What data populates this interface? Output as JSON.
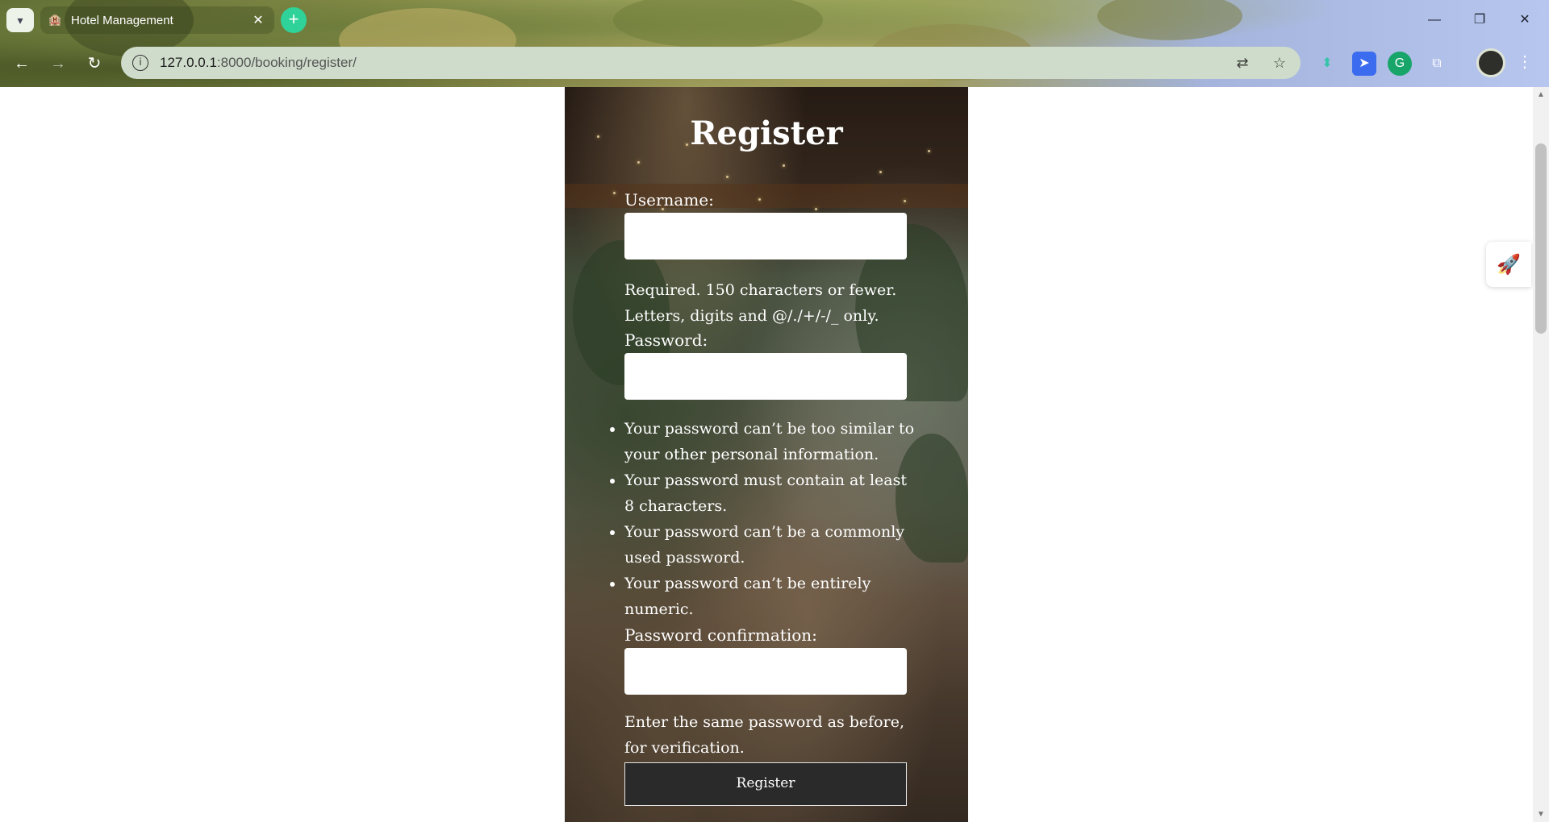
{
  "browser": {
    "tab_title": "Hotel Management",
    "tab_close": "✕",
    "new_tab": "+",
    "url_host": "127.0.0.1",
    "url_path": ":8000/booking/register/",
    "window_buttons": {
      "minimize": "—",
      "restore": "❐",
      "close": "✕"
    }
  },
  "icons": {
    "tab_menu": "chevron-down-icon",
    "back": "arrow-left-icon",
    "forward": "arrow-right-icon",
    "reload": "reload-icon",
    "site_info": "info-icon",
    "translate": "translate-icon",
    "bookmark": "star-icon",
    "extensions": "puzzle-icon",
    "menu": "kebab-menu-icon",
    "side_widget": "rocket-icon"
  },
  "form": {
    "title": "Register",
    "username_label": "Username:",
    "username_help": "Required. 150 characters or fewer. Letters, digits and @/./+/-/_ only.",
    "password_label": "Password:",
    "password_rules": [
      "Your password can’t be too similar to your other personal information.",
      "Your password must contain at least 8 characters.",
      "Your password can’t be a commonly used password.",
      "Your password can’t be entirely numeric."
    ],
    "confirm_label": "Password confirmation:",
    "confirm_help": "Enter the same password as before, for verification.",
    "submit_label": "Register"
  },
  "colors": {
    "submit_bg": "#2a2a2a",
    "accent_new_tab": "#2fd39a",
    "omnibox_bg": "#cfdccb"
  }
}
